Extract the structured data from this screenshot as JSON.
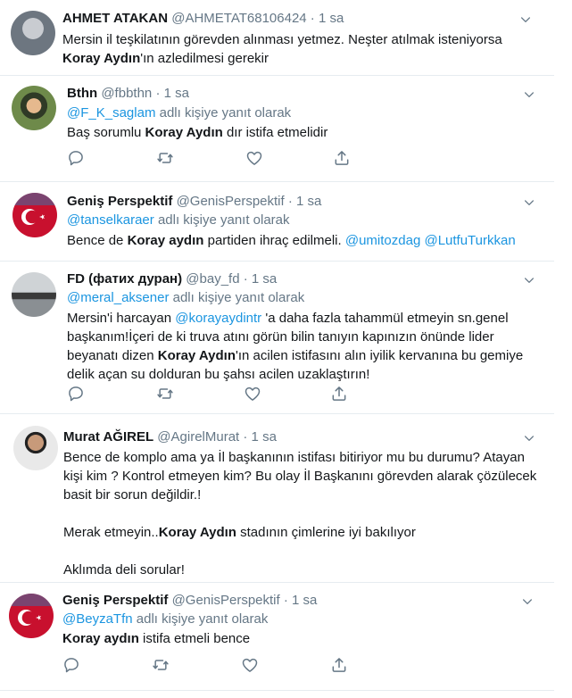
{
  "tweets": [
    {
      "name": "AHMET ATAKAN",
      "handle": "@AHMETAT68106424",
      "time": "· 1 sa",
      "text_a": "Mersin il teşkilatının görevden alınması yetmez. Neşter atılmak isteniyorsa",
      "text_b_bold": "Koray Aydın",
      "text_b_rest": "'ın azledilmesi gerekir"
    },
    {
      "name": "Bthn",
      "handle": "@fbbthn",
      "time": "· 1 sa",
      "reply_user": "@F_K_saglam",
      "reply_suffix": " adlı kişiye yanıt olarak",
      "text_pre": "Baş sorumlu ",
      "text_bold": "Koray Aydın",
      "text_post": " dır istifa etmelidir"
    },
    {
      "name": "Geniş Perspektif",
      "handle": "@GenisPerspektif",
      "time": "· 1 sa",
      "reply_user": "@tanselkaraer",
      "reply_suffix": " adlı kişiye yanıt olarak",
      "text_pre": "Bence de ",
      "text_bold": "Koray aydın",
      "text_post": " partiden ihraç edilmeli. ",
      "mention1": "@umitozdag",
      "mention2": "@LutfuTurkkan"
    },
    {
      "name": "FD (фатих дуран)",
      "handle": "@bay_fd",
      "time": "· 1 sa",
      "reply_user": "@meral_aksener",
      "reply_suffix": " adlı kişiye yanıt olarak",
      "l1_pre": "Mersin'i harcayan ",
      "l1_mention": "@korayaydintr",
      "l1_post": " 'a daha fazla tahammül etmeyin sn.genel",
      "l2": "başkanım!İçeri de ki truva atını görün bilin tanıyın kapınızın önünde lider",
      "l3_pre": "beyanatı dizen ",
      "l3_bold": "Koray Aydın",
      "l3_post": "'ın acilen istifasını alın iyilik kervanına bu gemiye",
      "l4": "delik açan su dolduran bu şahsı acilen uzaklaştırın!"
    },
    {
      "name": "Murat AĞIREL",
      "handle": "@AgirelMurat",
      "time": "· 1 sa",
      "l1": "Bence de komplo ama ya İl başkanının istifası bitiriyor mu bu durumu? Atayan",
      "l2": "kişi kim ? Kontrol etmeyen kim? Bu olay İl Başkanını görevden alarak çözülecek",
      "l3": "basit bir sorun değildir.!",
      "p2_pre": "Merak etmeyin..",
      "p2_bold": "Koray Aydın",
      "p2_post": " stadının çimlerine iyi bakılıyor",
      "p3": "Aklımda deli sorular!"
    },
    {
      "name": "Geniş Perspektif",
      "handle": "@GenisPerspektif",
      "time": "· 1 sa",
      "reply_user": "@BeyzaTfn",
      "reply_suffix": " adlı kişiye yanıt olarak",
      "text_bold": "Koray aydın",
      "text_post": " istifa etmeli bence"
    }
  ],
  "icons": [
    "reply-icon",
    "retweet-icon",
    "like-icon",
    "share-icon",
    "chevron-down-icon"
  ],
  "colors": {
    "link": "#1b95e0",
    "muted": "#657786",
    "separator": "#e6ecf0",
    "text": "#14171a"
  }
}
